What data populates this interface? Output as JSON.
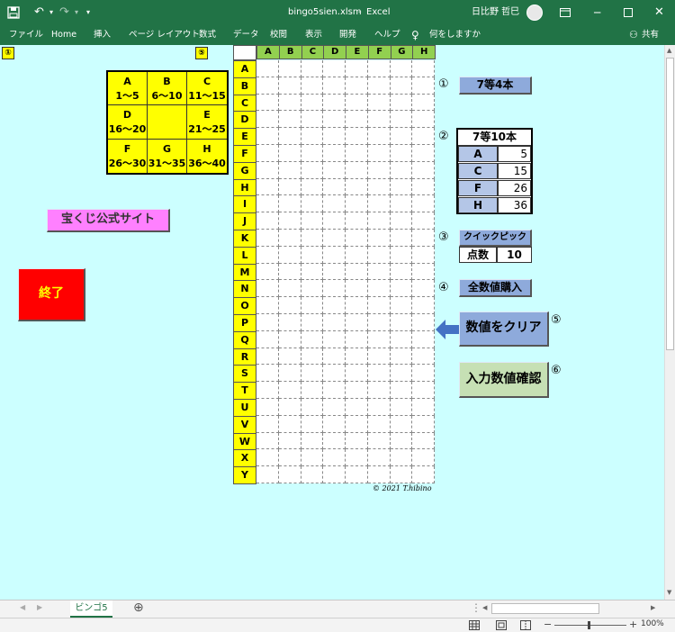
{
  "titlebar": {
    "filename": "bingo5sien.xlsm",
    "separator": "-",
    "app": "Excel",
    "user": "日比野 哲巳"
  },
  "ribbon": {
    "tabs": [
      "ファイル",
      "Home",
      "挿入",
      "ページ レイアウト",
      "数式",
      "データ",
      "校閲",
      "表示",
      "開発",
      "ヘルプ"
    ],
    "tell_me": "何をしますか",
    "share": "共有"
  },
  "corner": {
    "left_marker": "①",
    "right_marker": "⑤"
  },
  "ranges": [
    {
      "letter": "A",
      "range": "1～5"
    },
    {
      "letter": "B",
      "range": "6～10"
    },
    {
      "letter": "C",
      "range": "11～15"
    },
    {
      "letter": "D",
      "range": "16～20"
    },
    {
      "letter": "",
      "range": ""
    },
    {
      "letter": "E",
      "range": "21～25"
    },
    {
      "letter": "F",
      "range": "26～30"
    },
    {
      "letter": "G",
      "range": "31～35"
    },
    {
      "letter": "H",
      "range": "36～40"
    }
  ],
  "buttons": {
    "official_site": "宝くじ公式サイト",
    "exit": "終了",
    "prize7_4": "7等4本",
    "quick_pick": "クイックピック",
    "buy_all": "全数値購入",
    "clear": "数値をクリア",
    "confirm": "入力数値確認"
  },
  "markers": {
    "m1": "①",
    "m2": "②",
    "m3": "③",
    "m4": "④",
    "m5": "⑤",
    "m6": "⑥"
  },
  "grid": {
    "columns": [
      "A",
      "B",
      "C",
      "D",
      "E",
      "F",
      "G",
      "H"
    ],
    "rows": [
      "A",
      "B",
      "C",
      "D",
      "E",
      "F",
      "G",
      "H",
      "I",
      "J",
      "K",
      "L",
      "M",
      "N",
      "O",
      "P",
      "Q",
      "R",
      "S",
      "T",
      "U",
      "V",
      "W",
      "X",
      "Y"
    ],
    "copyright": "© 2021  T.hibino"
  },
  "prize7_10": {
    "title": "7等10本",
    "rows": [
      {
        "letter": "A",
        "value": "5"
      },
      {
        "letter": "C",
        "value": "15"
      },
      {
        "letter": "F",
        "value": "26"
      },
      {
        "letter": "H",
        "value": "36"
      }
    ]
  },
  "points": {
    "label": "点数",
    "value": "10"
  },
  "sheet_tab": "ビンゴ5",
  "zoom": "100%",
  "colors": {
    "excel_green": "#217346",
    "sheet_bg": "#ccffff",
    "yellow": "#ffff00",
    "button_blue": "#8eaadb",
    "button_pink": "#ff80ff",
    "button_red": "#ff0000",
    "button_green": "#c6e0b4",
    "header_green": "#92d050"
  }
}
